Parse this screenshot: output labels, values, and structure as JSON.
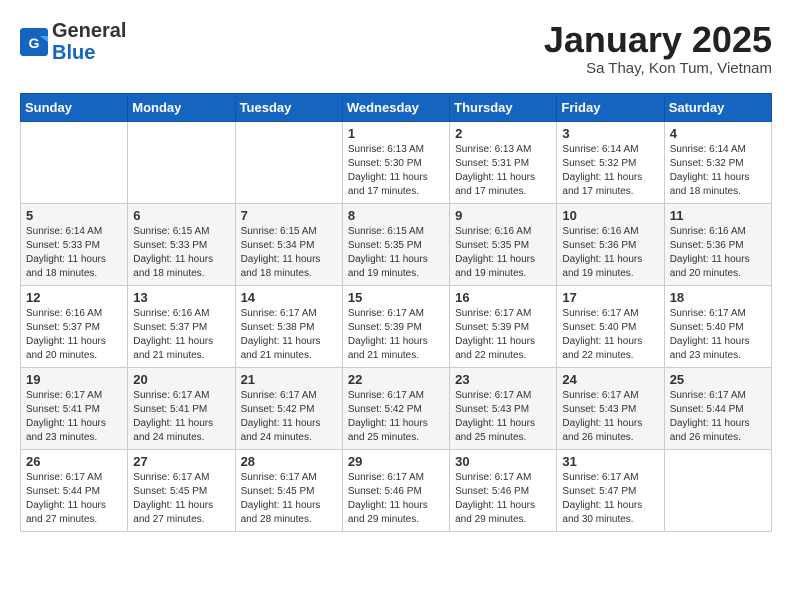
{
  "header": {
    "logo_general": "General",
    "logo_blue": "Blue",
    "month_title": "January 2025",
    "location": "Sa Thay, Kon Tum, Vietnam"
  },
  "days_of_week": [
    "Sunday",
    "Monday",
    "Tuesday",
    "Wednesday",
    "Thursday",
    "Friday",
    "Saturday"
  ],
  "weeks": [
    [
      {
        "day": "",
        "info": ""
      },
      {
        "day": "",
        "info": ""
      },
      {
        "day": "",
        "info": ""
      },
      {
        "day": "1",
        "info": "Sunrise: 6:13 AM\nSunset: 5:30 PM\nDaylight: 11 hours and 17 minutes."
      },
      {
        "day": "2",
        "info": "Sunrise: 6:13 AM\nSunset: 5:31 PM\nDaylight: 11 hours and 17 minutes."
      },
      {
        "day": "3",
        "info": "Sunrise: 6:14 AM\nSunset: 5:32 PM\nDaylight: 11 hours and 17 minutes."
      },
      {
        "day": "4",
        "info": "Sunrise: 6:14 AM\nSunset: 5:32 PM\nDaylight: 11 hours and 18 minutes."
      }
    ],
    [
      {
        "day": "5",
        "info": "Sunrise: 6:14 AM\nSunset: 5:33 PM\nDaylight: 11 hours and 18 minutes."
      },
      {
        "day": "6",
        "info": "Sunrise: 6:15 AM\nSunset: 5:33 PM\nDaylight: 11 hours and 18 minutes."
      },
      {
        "day": "7",
        "info": "Sunrise: 6:15 AM\nSunset: 5:34 PM\nDaylight: 11 hours and 18 minutes."
      },
      {
        "day": "8",
        "info": "Sunrise: 6:15 AM\nSunset: 5:35 PM\nDaylight: 11 hours and 19 minutes."
      },
      {
        "day": "9",
        "info": "Sunrise: 6:16 AM\nSunset: 5:35 PM\nDaylight: 11 hours and 19 minutes."
      },
      {
        "day": "10",
        "info": "Sunrise: 6:16 AM\nSunset: 5:36 PM\nDaylight: 11 hours and 19 minutes."
      },
      {
        "day": "11",
        "info": "Sunrise: 6:16 AM\nSunset: 5:36 PM\nDaylight: 11 hours and 20 minutes."
      }
    ],
    [
      {
        "day": "12",
        "info": "Sunrise: 6:16 AM\nSunset: 5:37 PM\nDaylight: 11 hours and 20 minutes."
      },
      {
        "day": "13",
        "info": "Sunrise: 6:16 AM\nSunset: 5:37 PM\nDaylight: 11 hours and 21 minutes."
      },
      {
        "day": "14",
        "info": "Sunrise: 6:17 AM\nSunset: 5:38 PM\nDaylight: 11 hours and 21 minutes."
      },
      {
        "day": "15",
        "info": "Sunrise: 6:17 AM\nSunset: 5:39 PM\nDaylight: 11 hours and 21 minutes."
      },
      {
        "day": "16",
        "info": "Sunrise: 6:17 AM\nSunset: 5:39 PM\nDaylight: 11 hours and 22 minutes."
      },
      {
        "day": "17",
        "info": "Sunrise: 6:17 AM\nSunset: 5:40 PM\nDaylight: 11 hours and 22 minutes."
      },
      {
        "day": "18",
        "info": "Sunrise: 6:17 AM\nSunset: 5:40 PM\nDaylight: 11 hours and 23 minutes."
      }
    ],
    [
      {
        "day": "19",
        "info": "Sunrise: 6:17 AM\nSunset: 5:41 PM\nDaylight: 11 hours and 23 minutes."
      },
      {
        "day": "20",
        "info": "Sunrise: 6:17 AM\nSunset: 5:41 PM\nDaylight: 11 hours and 24 minutes."
      },
      {
        "day": "21",
        "info": "Sunrise: 6:17 AM\nSunset: 5:42 PM\nDaylight: 11 hours and 24 minutes."
      },
      {
        "day": "22",
        "info": "Sunrise: 6:17 AM\nSunset: 5:42 PM\nDaylight: 11 hours and 25 minutes."
      },
      {
        "day": "23",
        "info": "Sunrise: 6:17 AM\nSunset: 5:43 PM\nDaylight: 11 hours and 25 minutes."
      },
      {
        "day": "24",
        "info": "Sunrise: 6:17 AM\nSunset: 5:43 PM\nDaylight: 11 hours and 26 minutes."
      },
      {
        "day": "25",
        "info": "Sunrise: 6:17 AM\nSunset: 5:44 PM\nDaylight: 11 hours and 26 minutes."
      }
    ],
    [
      {
        "day": "26",
        "info": "Sunrise: 6:17 AM\nSunset: 5:44 PM\nDaylight: 11 hours and 27 minutes."
      },
      {
        "day": "27",
        "info": "Sunrise: 6:17 AM\nSunset: 5:45 PM\nDaylight: 11 hours and 27 minutes."
      },
      {
        "day": "28",
        "info": "Sunrise: 6:17 AM\nSunset: 5:45 PM\nDaylight: 11 hours and 28 minutes."
      },
      {
        "day": "29",
        "info": "Sunrise: 6:17 AM\nSunset: 5:46 PM\nDaylight: 11 hours and 29 minutes."
      },
      {
        "day": "30",
        "info": "Sunrise: 6:17 AM\nSunset: 5:46 PM\nDaylight: 11 hours and 29 minutes."
      },
      {
        "day": "31",
        "info": "Sunrise: 6:17 AM\nSunset: 5:47 PM\nDaylight: 11 hours and 30 minutes."
      },
      {
        "day": "",
        "info": ""
      }
    ]
  ]
}
